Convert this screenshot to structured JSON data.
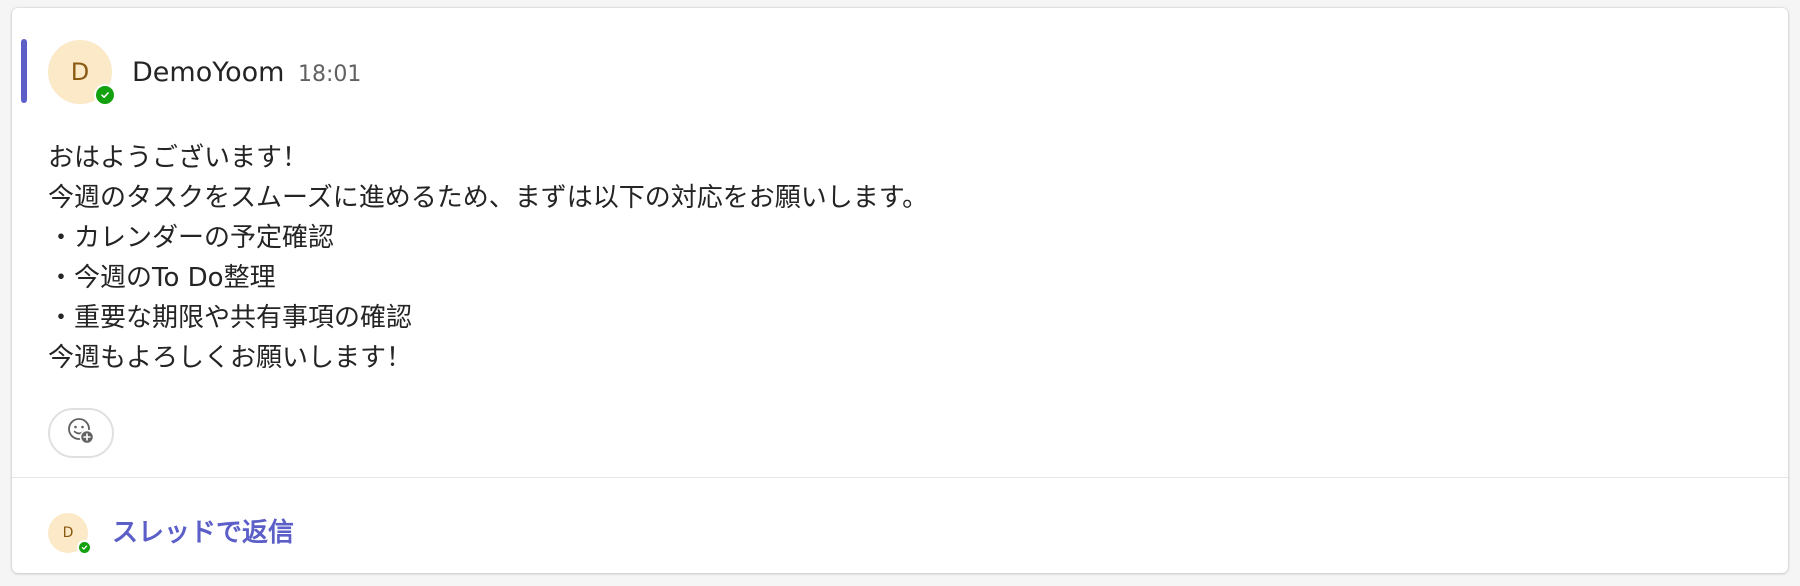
{
  "message": {
    "avatar_initial": "D",
    "sender": "DemoYoom",
    "time": "18:01",
    "status": "available",
    "lines": [
      "おはようございます！",
      "今週のタスクをスムーズに進めるため、まずは以下の対応をお願いします。",
      "・カレンダーの予定確認",
      "・今週のTo Do整理",
      "・重要な期限や共有事項の確認",
      "今週もよろしくお願いします！"
    ]
  },
  "reactions": {
    "add_icon": "emoji-add-icon"
  },
  "reply": {
    "avatar_initial": "D",
    "label": "スレッドで返信"
  },
  "colors": {
    "accent": "#5b5fc7",
    "presence": "#13a10e",
    "avatar_bg": "#fbe9c7",
    "avatar_text": "#8a5a12"
  }
}
